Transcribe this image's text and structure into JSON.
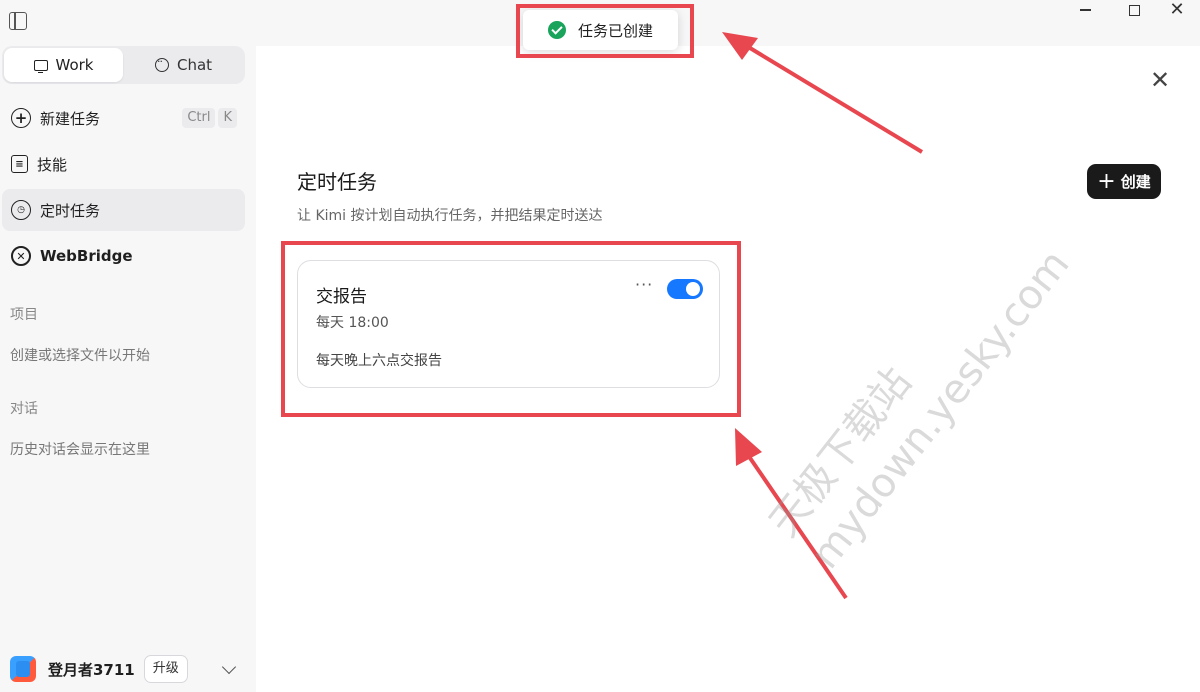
{
  "window": {
    "close_glyph": "✕"
  },
  "sidebar": {
    "modes": [
      {
        "label": "Work",
        "icon": "monitor-icon",
        "active": true
      },
      {
        "label": "Chat",
        "icon": "chat-bubble-icon",
        "active": false
      }
    ],
    "nav": [
      {
        "label": "新建任务",
        "icon": "plus-circle-icon",
        "shortcut": [
          "Ctrl",
          "K"
        ]
      },
      {
        "label": "技能",
        "icon": "skills-icon"
      },
      {
        "label": "定时任务",
        "icon": "alarm-clock-icon",
        "active": true
      },
      {
        "label": "WebBridge",
        "icon": "webbridge-icon"
      }
    ],
    "projects_label": "项目",
    "projects_hint": "创建或选择文件以开始",
    "chats_label": "对话",
    "chats_hint": "历史对话会显示在这里",
    "user": {
      "name": "登月者3711",
      "upgrade_label": "升级"
    }
  },
  "toast": {
    "text": "任务已创建",
    "icon": "success-check-icon",
    "color": "#19a35b"
  },
  "main": {
    "close_glyph": "✕",
    "title": "定时任务",
    "subtitle": "让 Kimi 按计划自动执行任务，并把结果定时送达",
    "create_label": "创建",
    "create_glyph": "+",
    "tasks": [
      {
        "title": "交报告",
        "schedule": "每天 18:00",
        "description": "每天晚上六点交报告",
        "more_glyph": "···",
        "enabled": true
      }
    ]
  },
  "watermark": {
    "line1": "天极下载站",
    "line2": "mydown.yesky.com"
  },
  "colors": {
    "accent": "#1677ff",
    "annotation": "#e8474f",
    "button_dark": "#1a1a1a"
  }
}
